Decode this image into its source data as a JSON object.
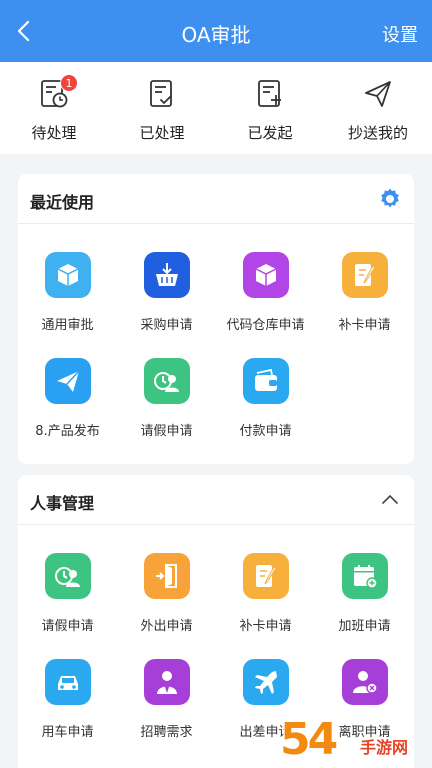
{
  "header": {
    "title": "OA审批",
    "settings_label": "设置"
  },
  "quickbar": [
    {
      "label": "待处理",
      "icon": "pending-icon",
      "badge": "1"
    },
    {
      "label": "已处理",
      "icon": "processed-icon"
    },
    {
      "label": "已发起",
      "icon": "initiated-icon"
    },
    {
      "label": "抄送我的",
      "icon": "cc-me-icon"
    }
  ],
  "recent": {
    "title": "最近使用",
    "items": [
      {
        "label": "通用审批",
        "icon": "cube-icon",
        "color": "#3fb0f0"
      },
      {
        "label": "采购申请",
        "icon": "basket-icon",
        "color": "#1f5fe0"
      },
      {
        "label": "代码仓库申请",
        "icon": "cube-icon",
        "color": "#b245e6"
      },
      {
        "label": "补卡申请",
        "icon": "note-pen-icon",
        "color": "#f8b03c"
      },
      {
        "label": "8.产品发布",
        "icon": "paper-plane-icon",
        "color": "#2aa0f2"
      },
      {
        "label": "请假申请",
        "icon": "leave-icon",
        "color": "#3ec482"
      },
      {
        "label": "付款申请",
        "icon": "wallet-icon",
        "color": "#2aa8f0"
      }
    ]
  },
  "hr": {
    "title": "人事管理",
    "items": [
      {
        "label": "请假申请",
        "icon": "leave-icon",
        "color": "#3ec482"
      },
      {
        "label": "外出申请",
        "icon": "door-exit-icon",
        "color": "#f8a23a"
      },
      {
        "label": "补卡申请",
        "icon": "note-pen-icon",
        "color": "#f8b03c"
      },
      {
        "label": "加班申请",
        "icon": "calendar-add-icon",
        "color": "#3ec482"
      },
      {
        "label": "用车申请",
        "icon": "car-icon",
        "color": "#2aa8f0"
      },
      {
        "label": "招聘需求",
        "icon": "person-tie-icon",
        "color": "#a63fd8"
      },
      {
        "label": "出差申请",
        "icon": "airplane-icon",
        "color": "#2aa8f0"
      },
      {
        "label": "离职申请",
        "icon": "person-remove-icon",
        "color": "#a63fd8"
      }
    ]
  },
  "watermark": {
    "number": "54",
    "text": "手游网"
  }
}
